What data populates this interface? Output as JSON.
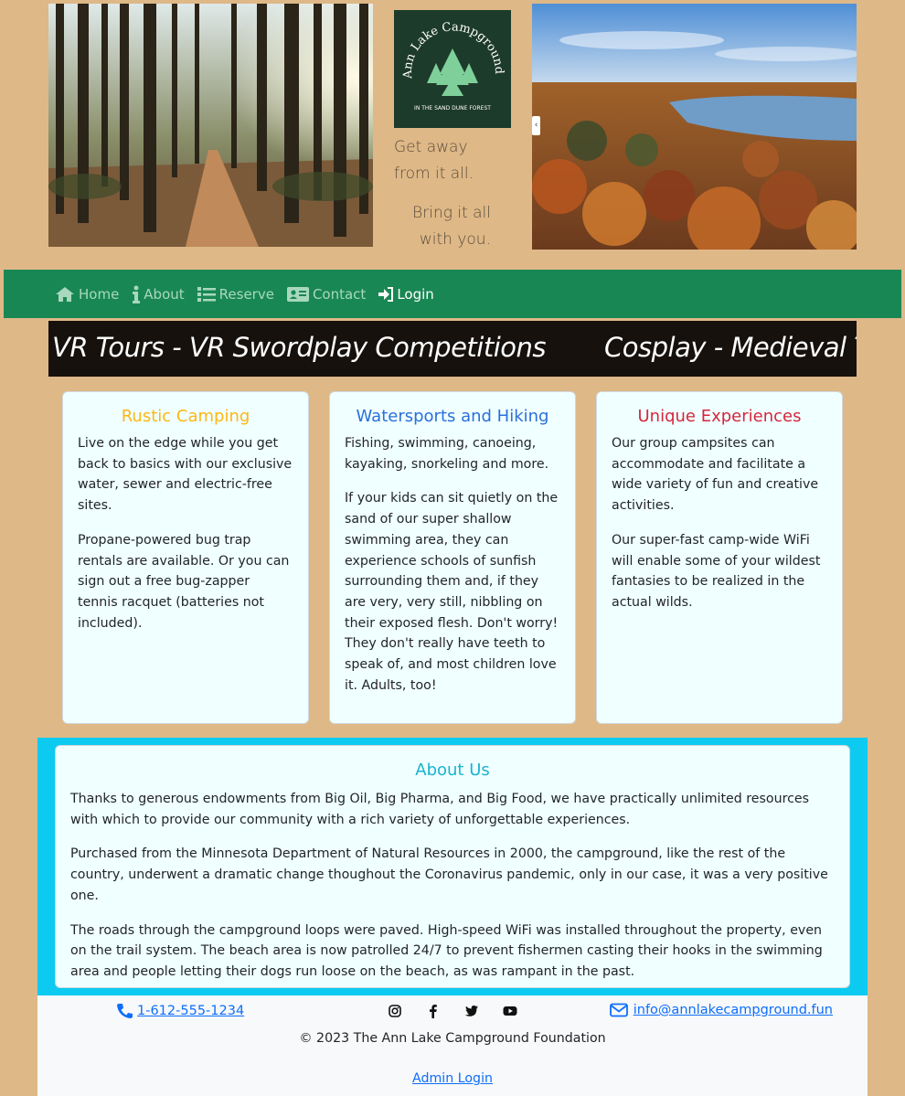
{
  "header": {
    "logo": {
      "name": "Ann Lake Campground",
      "subtitle": "IN THE SAND DUNE FOREST"
    },
    "tagline_1": "Get away from it all.",
    "tagline_2": "Bring it all with you.",
    "images": [
      "forest-trail-photo",
      "autumn-lake-aerial-photo"
    ]
  },
  "nav": {
    "items": [
      {
        "label": "Home",
        "icon": "home-icon"
      },
      {
        "label": "About",
        "icon": "info-icon"
      },
      {
        "label": "Reserve",
        "icon": "list-icon"
      },
      {
        "label": "Contact",
        "icon": "id-card-icon"
      },
      {
        "label": "Login",
        "icon": "sign-in-icon",
        "active": true
      }
    ]
  },
  "marquee": {
    "text_1": "VR Tours - VR Swordplay Competitions",
    "text_2": "Cosplay - Medieval Tour"
  },
  "cards": [
    {
      "title": "Rustic Camping",
      "color": "#ffb612",
      "paragraphs": [
        "Live on the edge while you get back to basics with our exclusive water, sewer and electric-free sites.",
        "Propane-powered bug trap rentals are available. Or you can sign out a free bug-zapper tennis racquet (batteries not included)."
      ]
    },
    {
      "title": "Watersports and Hiking",
      "color": "#2a6fdb",
      "paragraphs": [
        "Fishing, swimming, canoeing, kayaking, snorkeling and more.",
        "If your kids can sit quietly on the sand of our super shallow swimming area, they can experience schools of sunfish surrounding them and, if they are very, very still, nibbling on their exposed flesh. Don't worry! They don't really have teeth to speak of, and most children love it. Adults, too!"
      ]
    },
    {
      "title": "Unique Experiences",
      "color": "#d7263d",
      "paragraphs": [
        "Our group campsites can accommodate and facilitate a wide variety of fun and creative activities.",
        "Our super-fast camp-wide WiFi will enable some of your wildest fantasies to be realized in the actual wilds."
      ]
    }
  ],
  "about": {
    "title": "About Us",
    "paragraphs": [
      "Thanks to generous endowments from Big Oil, Big Pharma, and Big Food, we have practically unlimited resources with which to provide our community with a rich variety of unforgettable experiences.",
      "Purchased from the Minnesota Department of Natural Resources in 2000, the campground, like the rest of the country, underwent a dramatic change thoughout the Coronavirus pandemic, only in our case, it was a very positive one.",
      "The roads through the campground loops were paved. High-speed WiFi was installed throughout the property, even on the trail system. The beach area is now patrolled 24/7 to prevent fishermen casting their hooks in the swimming area and people letting their dogs run loose on the beach, as was rampant in the past."
    ]
  },
  "footer": {
    "phone": "1-612-555-1234",
    "email": "info@annlakecampground.fun",
    "socials": [
      "instagram-icon",
      "facebook-icon",
      "twitter-icon",
      "youtube-icon"
    ],
    "copyright": "© 2023 The Ann Lake Campground Foundation",
    "admin_login": "Admin Login"
  },
  "colors": {
    "page_bg": "#deb887",
    "navbar_bg": "#198754",
    "about_band": "#0dcaf0",
    "card_bg": "#f0ffff",
    "link": "#0d6efd"
  }
}
